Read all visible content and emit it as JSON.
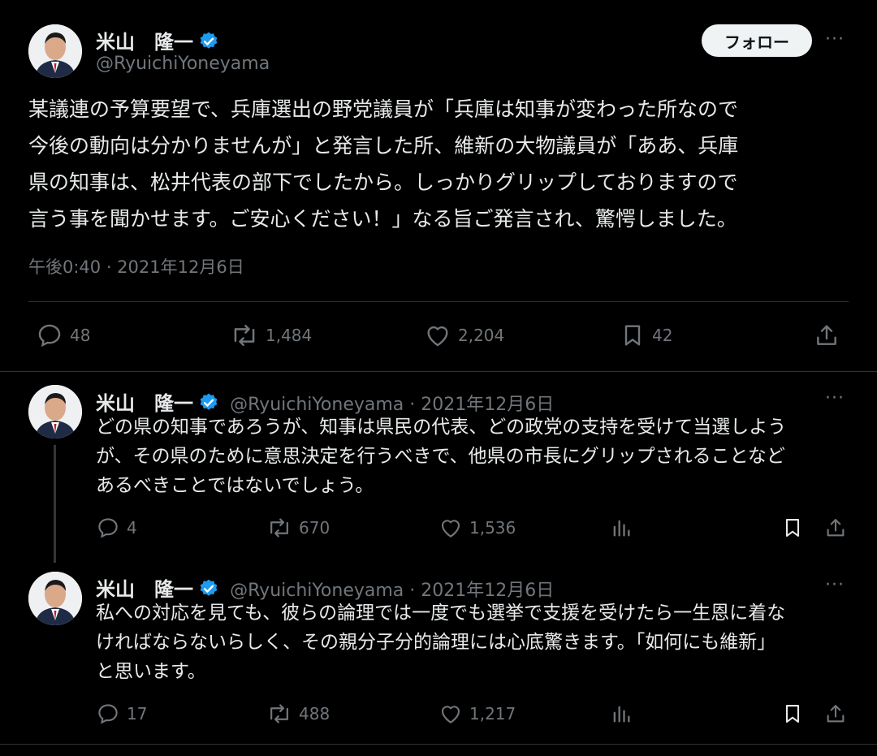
{
  "main_tweet": {
    "author_name": "米山　隆一",
    "handle": "@RyuichiYoneyama",
    "follow_label": "フォロー",
    "more_label": "···",
    "text": "某議連の予算要望で、兵庫選出の野党議員が「兵庫は知事が変わった所なので\n今後の動向は分かりませんが」と発言した所、維新の大物議員が「ああ、兵庫\n県の知事は、松井代表の部下でしたから。しっかりグリップしておりますので\n言う事を聞かせます。ご安心ください！」なる旨ご発言され、驚愕しました。",
    "timestamp": "午後0:40 · 2021年12月6日",
    "replies": "48",
    "reposts": "1,484",
    "likes": "2,204",
    "bookmarks": "42"
  },
  "reply1": {
    "author_name": "米山　隆一",
    "handle_date": "@RyuichiYoneyama · 2021年12月6日",
    "more_label": "···",
    "text": "どの県の知事であろうが、知事は県民の代表、どの政党の支持を受けて当選しよう\nが、その県のために意思決定を行うべきで、他県の市長にグリップされることなど\nあるべきことではないでしょう。",
    "replies": "4",
    "reposts": "670",
    "likes": "1,536"
  },
  "reply2": {
    "author_name": "米山　隆一",
    "handle_date": "@RyuichiYoneyama · 2021年12月6日",
    "more_label": "···",
    "text": "私への対応を見ても、彼らの論理では一度でも選挙で支援を受けたら一生恩に着な\nければならないらしく、その親分子分的論理には心底驚きます。「如何にも維新」\nと思います。",
    "replies": "17",
    "reposts": "488",
    "likes": "1,217"
  },
  "colors": {
    "background": "#000000",
    "text": "#e7e9ea",
    "secondary": "#71767b",
    "verified": "#1d9bf0",
    "divider": "#2f3336"
  }
}
